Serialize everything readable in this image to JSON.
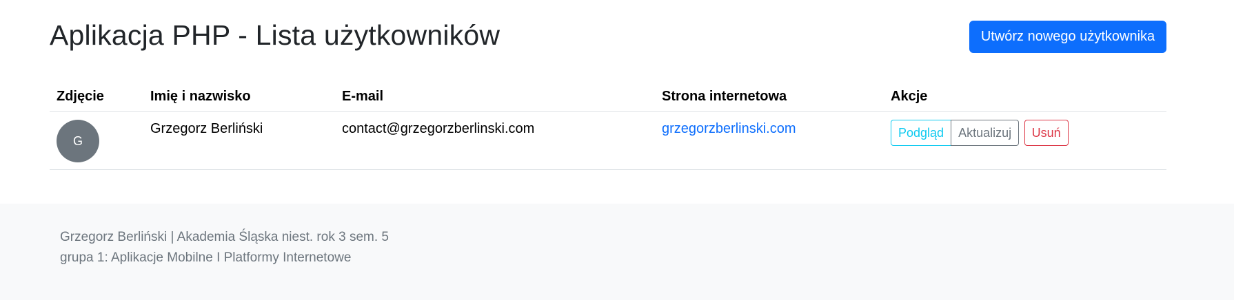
{
  "header": {
    "title": "Aplikacja PHP - Lista użytkowników",
    "create_button_label": "Utwórz nowego użytkownika"
  },
  "table": {
    "columns": [
      "Zdjęcie",
      "Imię i nazwisko",
      "E-mail",
      "Strona internetowa",
      "Akcje"
    ],
    "rows": [
      {
        "avatar_initial": "G",
        "name": "Grzegorz Berliński",
        "email": "contact@grzegorzberlinski.com",
        "website": "grzegorzberlinski.com",
        "actions": {
          "view": "Podgląd",
          "update": "Aktualizuj",
          "delete": "Usuń"
        }
      }
    ]
  },
  "footer": {
    "line1": "Grzegorz Berliński | Akademia Śląska niest. rok 3 sem. 5",
    "line2": "grupa 1: Aplikacje Mobilne I Platformy Internetowe"
  },
  "colors": {
    "primary": "#0d6efd",
    "info": "#0dcaf0",
    "secondary": "#6c757d",
    "danger": "#dc3545",
    "footer_bg": "#f8f9fa"
  }
}
